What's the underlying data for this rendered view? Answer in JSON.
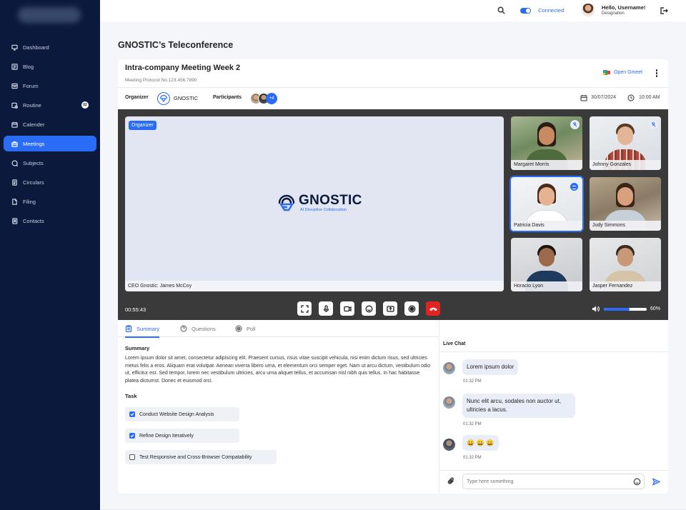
{
  "sidebar": {
    "items": [
      {
        "label": "Dashboard",
        "icon": "monitor-icon"
      },
      {
        "label": "Blog",
        "icon": "blog-icon"
      },
      {
        "label": "Forum",
        "icon": "forum-icon"
      },
      {
        "label": "Routine",
        "icon": "routine-icon",
        "badge": "02"
      },
      {
        "label": "Calender",
        "icon": "calendar-icon"
      },
      {
        "label": "Meetings",
        "icon": "briefcase-icon",
        "active": true
      },
      {
        "label": "Subjects",
        "icon": "chat-icon"
      },
      {
        "label": "Circulars",
        "icon": "document-icon"
      },
      {
        "label": "Filing",
        "icon": "file-icon"
      },
      {
        "label": "Contacts",
        "icon": "contacts-icon"
      }
    ]
  },
  "topbar": {
    "status": "Connected",
    "greeting": "Hello, Username!",
    "designation": "Designation"
  },
  "page": {
    "title": "GNOSTIC’s Teleconference"
  },
  "meeting": {
    "title": "Intra-company Meeting Week 2",
    "protocol": "Meeting Protocol No.123.456.7890",
    "open_gmeet": "Open Gmeet",
    "organizer_label": "Organizer",
    "organizer_name": "GNOSTIC",
    "participants_label": "Participants",
    "participants_more": "+4",
    "date": "30/07/2024",
    "time": "10:00 AM"
  },
  "video": {
    "organizer_tag": "Organizer",
    "brand_name": "GNOSTIC",
    "brand_tagline": "AI Disruptive Collaboration",
    "main_caption": "CEO Gnostic: James McCoy",
    "participants": [
      {
        "name": "Margaret Morris",
        "muted": true,
        "active": false
      },
      {
        "name": "Johnny Gonzales",
        "muted": true,
        "active": false
      },
      {
        "name": "Patricia Davis",
        "muted": false,
        "active": true,
        "speaking": true
      },
      {
        "name": "Judy Simmons",
        "muted": false,
        "active": false
      },
      {
        "name": "Horacio Lyon",
        "muted": false,
        "active": false
      },
      {
        "name": "Jasper Fernandez",
        "muted": false,
        "active": false
      }
    ],
    "elapsed": "00:55:43",
    "volume_pct": 60,
    "volume_label": "60%",
    "controls": [
      "fullscreen-icon",
      "microphone-icon",
      "camera-icon",
      "emoji-icon",
      "share-screen-icon",
      "record-icon",
      "end-call-icon"
    ]
  },
  "tabs": {
    "summary": "Summary",
    "questions": "Questions",
    "poll": "Poll"
  },
  "summary": {
    "heading": "Summary",
    "text": "Lorem ipsum dolor sit amet, consectetur adipiscing elit. Praesent cursus, risus vitae suscipit vehicula, nisi enim dictum risus, sed ultricies metus felis a eros. Aliquam erat volutpat. Aenean viverra libero urna, et elementum orci semper eget. Nam ut arcu dictum, vestibulum odio ut, efficitur est. Sed tempor, lorem nec vestibulum ultricies, arcu urna aliquet tellus, et accumsan nisl nibh quis tellus. In hac habitasse platea dictumst. Donec et euismod orci.",
    "task_heading": "Task",
    "tasks": [
      {
        "label": "Conduct Website Design Analysis",
        "done": true
      },
      {
        "label": "Refine Design Iteratively",
        "done": true
      },
      {
        "label": "Test Responsive and Cross-Browser Compatability",
        "done": false
      }
    ]
  },
  "chat": {
    "title": "Live Chat",
    "messages": [
      {
        "text": "Lorem ipsum dolor",
        "time": "01:32 PM"
      },
      {
        "text": "Nunc elit arcu, sodales non auctor ut, ultricies a lacus.",
        "time": "01:32 PM"
      },
      {
        "text": "😀 😀 😀",
        "time": "01:32 PM"
      }
    ],
    "placeholder": "Type here something"
  },
  "colors": {
    "accent": "#2a6cf6",
    "sidebar": "#0b1a3c",
    "end_call": "#e02424"
  }
}
